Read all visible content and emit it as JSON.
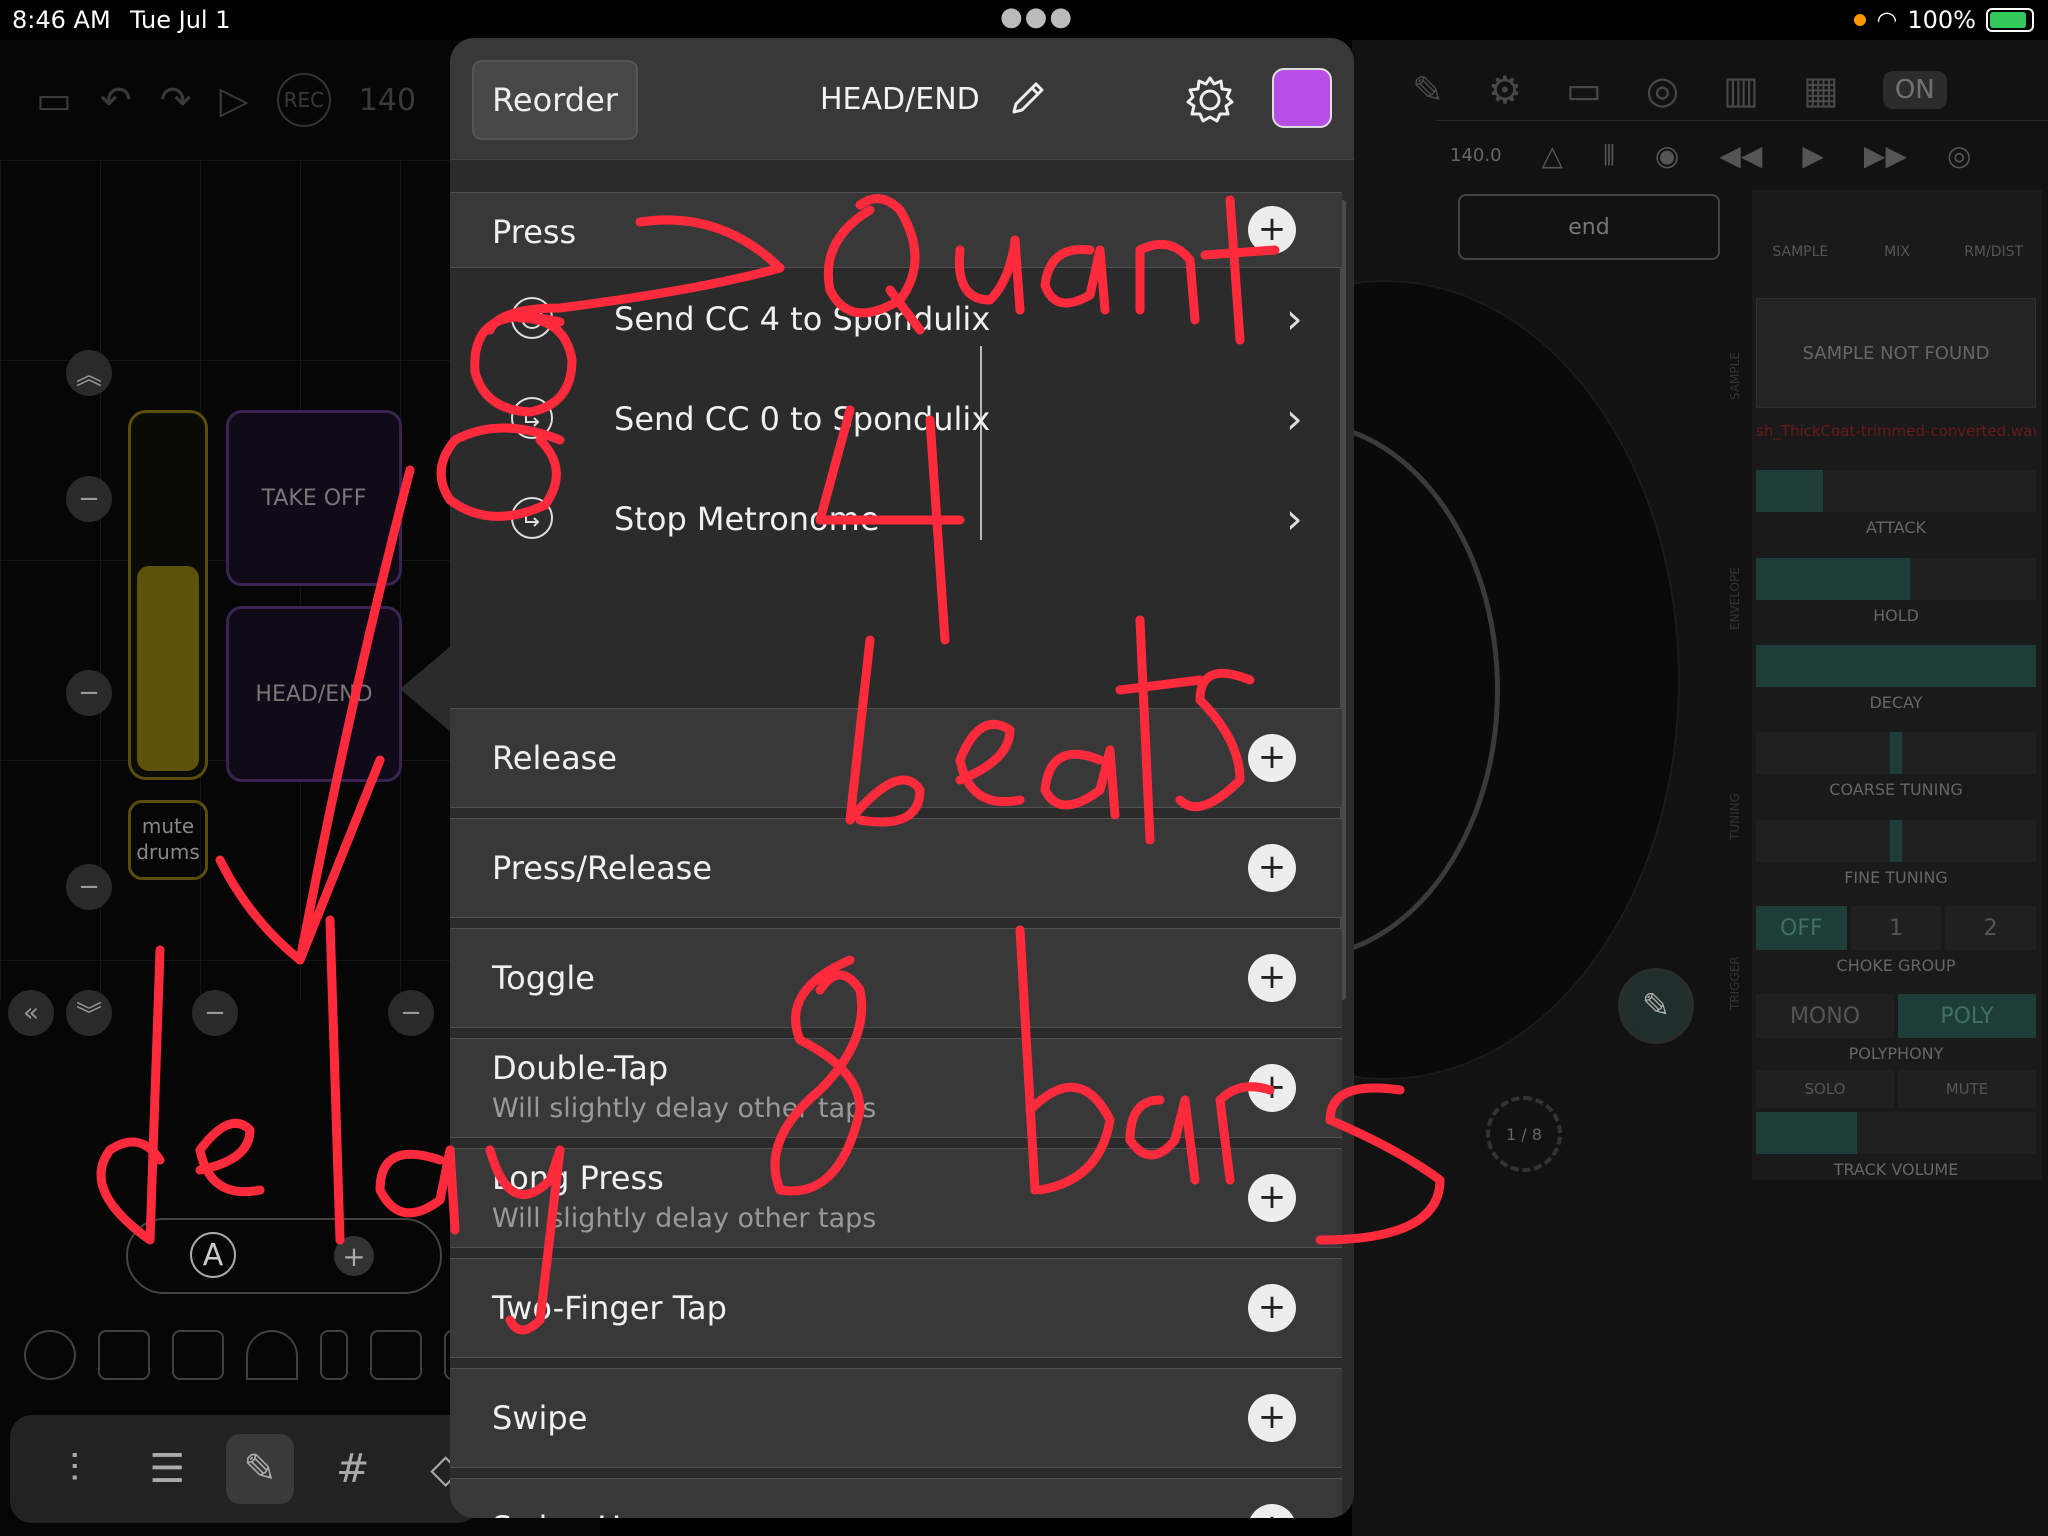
{
  "status": {
    "time": "8:46 AM",
    "date": "Tue Jul 1",
    "battery": "100%"
  },
  "left_panel": {
    "tempo_partial": "140",
    "rec_label": "REC",
    "pads": [
      "TAKE OFF",
      "HEAD/END"
    ],
    "mute_pad": "mute drums",
    "scene_letter": "A",
    "fader_level": 0.58
  },
  "popover": {
    "reorder_label": "Reorder",
    "title": "HEAD/END",
    "swatch_color": "#b94ee6",
    "press_section": {
      "label": "Press",
      "actions": [
        {
          "label": "Send CC 4 to Spondulix",
          "icon": "clock-icon"
        },
        {
          "label": "Send CC 0 to Spondulix",
          "icon": "return-arrow-icon"
        },
        {
          "label": "Stop Metronome",
          "icon": "return-arrow-icon"
        }
      ]
    },
    "sections": [
      {
        "label": "Release",
        "sub": ""
      },
      {
        "label": "Press/Release",
        "sub": ""
      },
      {
        "label": "Toggle",
        "sub": ""
      },
      {
        "label": "Double-Tap",
        "sub": "Will slightly delay other taps"
      },
      {
        "label": "Long Press",
        "sub": "Will slightly delay other taps"
      },
      {
        "label": "Two-Finger Tap",
        "sub": ""
      },
      {
        "label": "Swipe",
        "sub": ""
      },
      {
        "label": "Swipe Up",
        "sub": ""
      }
    ]
  },
  "right_panel": {
    "on_label": "ON",
    "tempo": "140.0",
    "end_field": "end",
    "tabs": [
      "SAMPLE",
      "MIX",
      "RM/DIST"
    ],
    "sample_status": "SAMPLE NOT FOUND",
    "sample_file": "sh_ThickCoat-trimmed-converted.wav",
    "attack_label": "ATTACK",
    "hold_label": "HOLD",
    "decay_label": "DECAY",
    "coarse_label": "COARSE TUNING",
    "fine_label": "FINE TUNING",
    "choke_options": [
      "OFF",
      "1",
      "2"
    ],
    "choke_label": "CHOKE GROUP",
    "mono_label": "MONO",
    "poly_label": "POLY",
    "polyphony_label": "POLYPHONY",
    "solo_label": "SOLO",
    "mute_label": "MUTE",
    "track_volume_label": "TRACK VOLUME",
    "fraction": "1 / 8",
    "side_labels": [
      "SAMPLE",
      "ENVELOPE",
      "TUNING",
      "TRIGGER"
    ],
    "attack_level": 0.24,
    "hold_level": 0.55,
    "decay_level": 1.0,
    "track_volume_level": 0.36
  },
  "annotations": [
    "Quant",
    "4 beats",
    "delay",
    "8 bars"
  ]
}
